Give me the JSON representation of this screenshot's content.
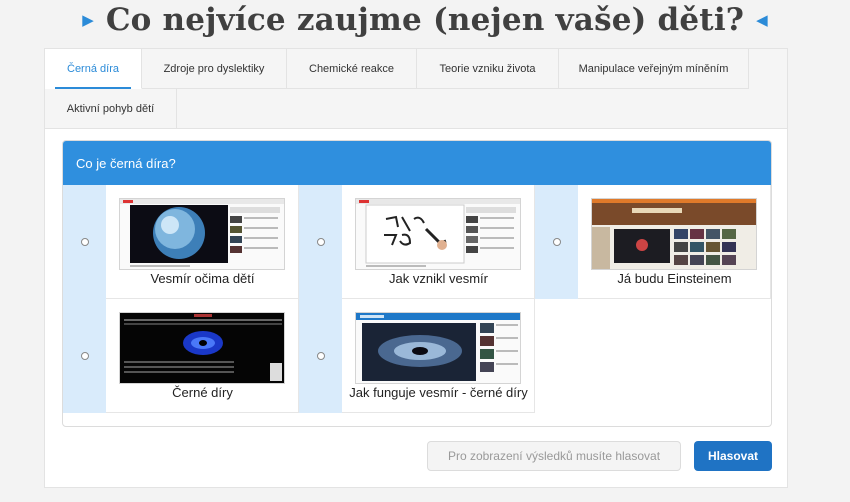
{
  "heading": {
    "title": "Co nejvíce zaujme (nejen vaše) děti?",
    "arrow_left": "▶",
    "arrow_right": "◀"
  },
  "tabs": [
    {
      "label": "Černá díra",
      "active": true
    },
    {
      "label": "Zdroje pro dyslektiky",
      "active": false
    },
    {
      "label": "Chemické reakce",
      "active": false
    },
    {
      "label": "Teorie vzniku života",
      "active": false
    },
    {
      "label": "Manipulace veřejným míněním",
      "active": false
    },
    {
      "label": "Aktivní pohyb dětí",
      "active": false
    }
  ],
  "poll": {
    "question": "Co je černá díra?",
    "options": [
      {
        "label": "Vesmír očima dětí",
        "thumbnail": "video-thumbnail-earth-globe"
      },
      {
        "label": "Jak vznikl vesmír",
        "thumbnail": "video-thumbnail-whiteboard-drawing"
      },
      {
        "label": "Já budu Einsteinem",
        "thumbnail": "video-thumbnail-website-grid"
      },
      {
        "label": "Černé díry",
        "thumbnail": "video-thumbnail-black-hole-dark"
      },
      {
        "label": "Jak funguje vesmír - černé díry",
        "thumbnail": "video-thumbnail-galaxy-swirl"
      }
    ]
  },
  "buttons": {
    "results_hint": "Pro zobrazení výsledků musíte hlasovat",
    "vote": "Hlasovat"
  },
  "colors": {
    "accent": "#2b8bd8",
    "poll_header": "#2f8fde",
    "vote_button": "#1f73c4",
    "radio_column": "#d9ebfb"
  }
}
